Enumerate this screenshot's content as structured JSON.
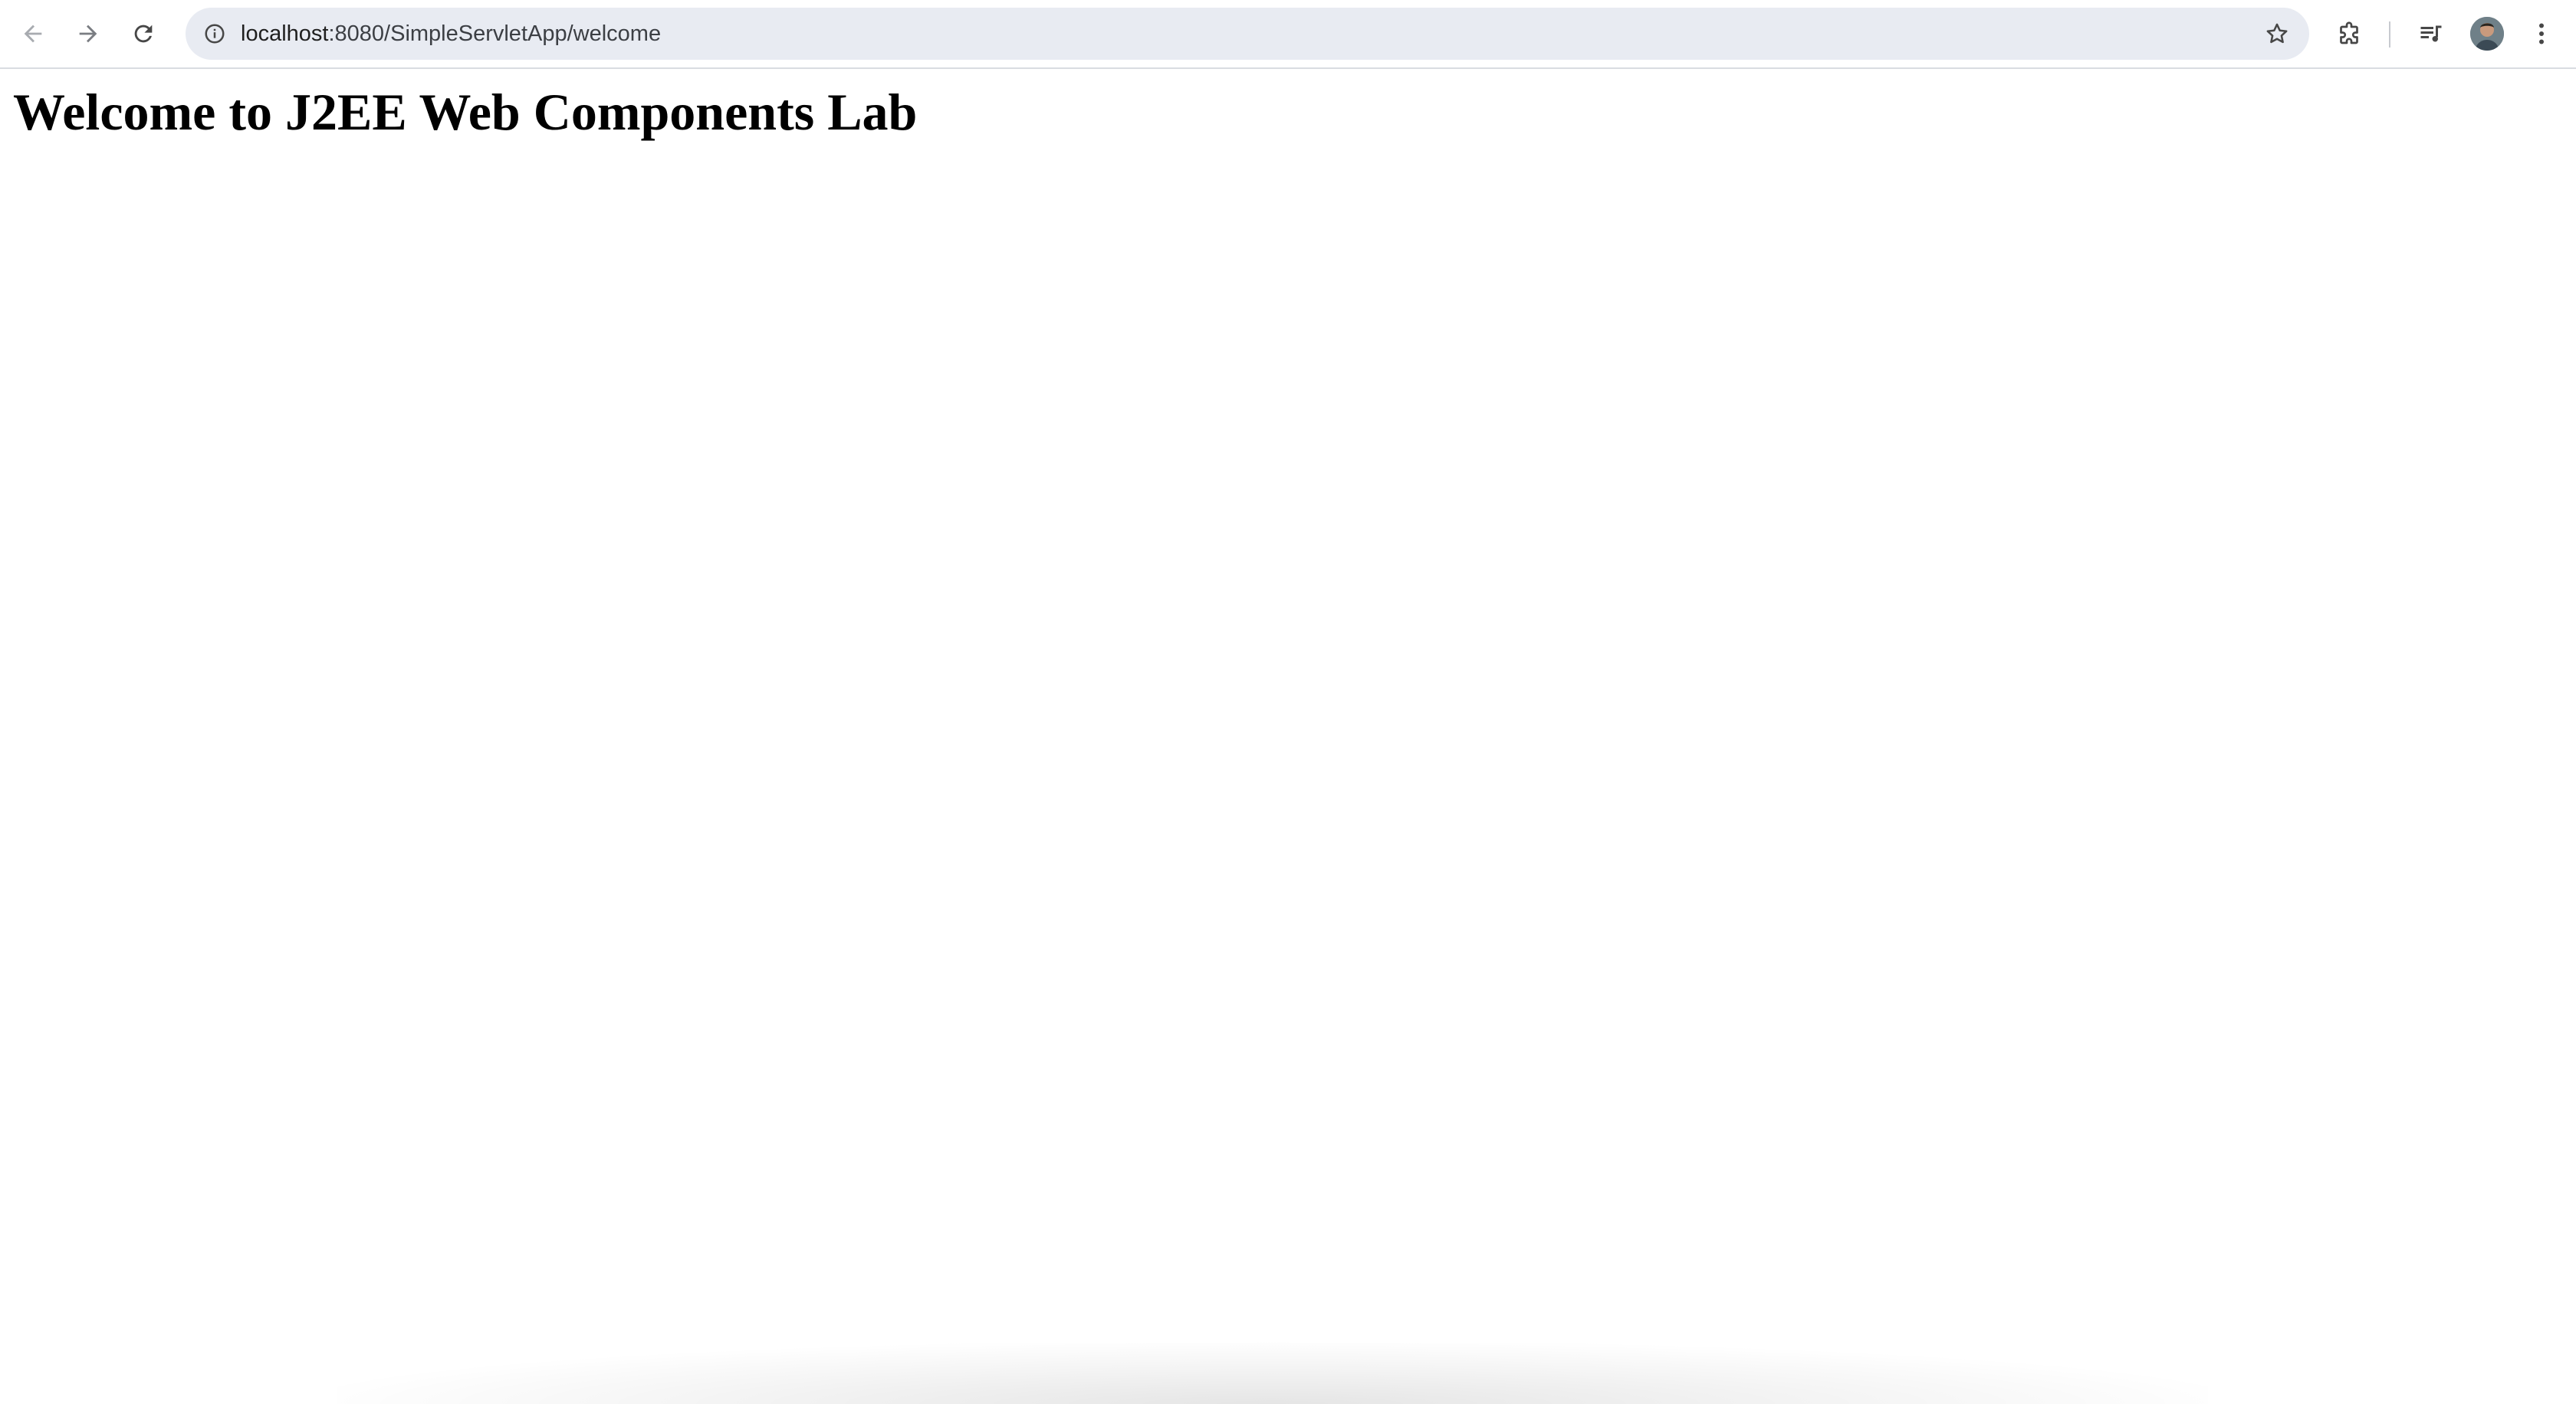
{
  "browser": {
    "url": {
      "host": "localhost",
      "path": ":8080/SimpleServletApp/welcome"
    },
    "icons": {
      "back": "arrow-left",
      "forward": "arrow-right",
      "reload": "reload",
      "site_info": "info-circle",
      "bookmark": "star",
      "extensions": "puzzle-piece",
      "media": "media-controls",
      "menu": "kebab-menu"
    },
    "colors": {
      "toolbar_bg": "#ffffff",
      "omnibox_bg": "#e8ebf2",
      "icon": "#474747",
      "icon_disabled": "#a8abb0"
    }
  },
  "page": {
    "heading": "Welcome to J2EE Web Components Lab"
  }
}
